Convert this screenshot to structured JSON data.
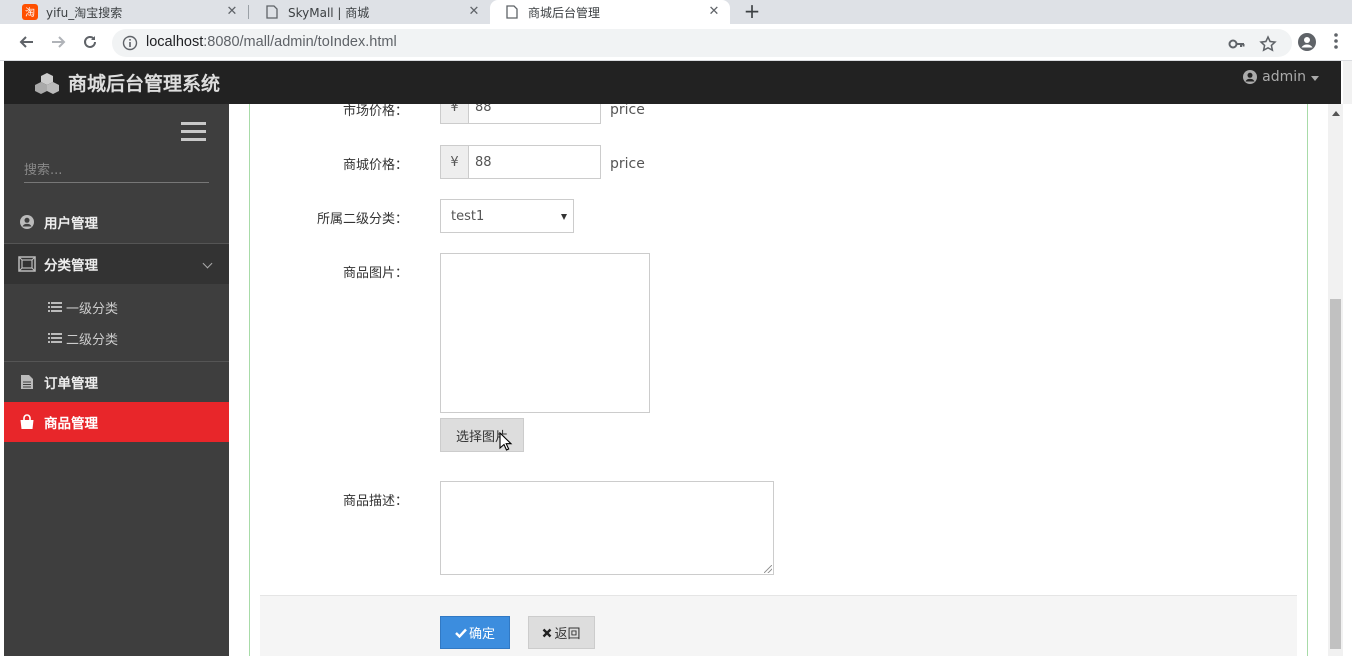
{
  "browser": {
    "tabs": [
      {
        "title": "yifu_淘宝搜索",
        "icon": "taobao-icon"
      },
      {
        "title": "SkyMall | 商城",
        "icon": "page-icon"
      },
      {
        "title": "商城后台管理",
        "icon": "page-icon",
        "active": true
      }
    ],
    "close_glyph": "✕",
    "new_tab_glyph": "+",
    "url_host": "localhost",
    "url_path": ":8080/mall/admin/toIndex.html"
  },
  "header": {
    "brand": "商城后台管理系统",
    "user": "admin"
  },
  "sidebar": {
    "search_placeholder": "搜索...",
    "items": [
      {
        "label": "用户管理",
        "icon": "user-circle-icon"
      },
      {
        "label": "分类管理",
        "icon": "category-icon",
        "expanded": true
      },
      {
        "label": "订单管理",
        "icon": "document-icon"
      },
      {
        "label": "商品管理",
        "icon": "shopping-bag-icon",
        "active": true
      }
    ],
    "sub_items": [
      {
        "label": "一级分类",
        "icon": "list-icon"
      },
      {
        "label": "二级分类",
        "icon": "list-icon"
      }
    ]
  },
  "form": {
    "market_price_label": "市场价格：",
    "market_price_value": "88",
    "mall_price_label": "商城价格：",
    "mall_price_value": "88",
    "currency": "¥",
    "unit": "price",
    "category_label": "所属二级分类：",
    "category_value": "test1",
    "image_label": "商品图片：",
    "choose_image": "选择图片",
    "desc_label": "商品描述：",
    "confirm": "确定",
    "back": "返回"
  },
  "colors": {
    "header_bg": "#222222",
    "sidebar_bg": "#3e3e3e",
    "active_item": "#e8262a",
    "primary_button": "#3c8dde"
  }
}
